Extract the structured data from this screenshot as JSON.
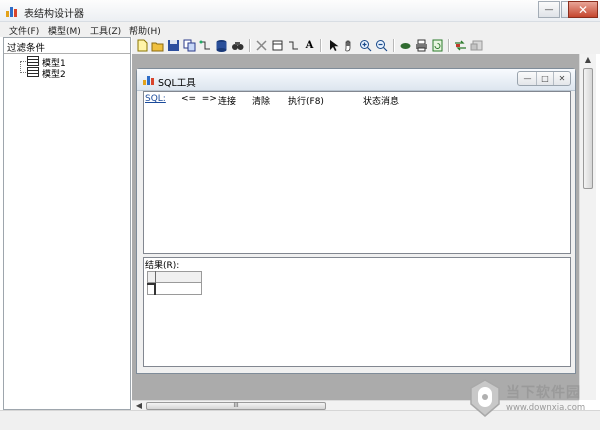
{
  "window": {
    "title": "表结构设计器",
    "buttons": {
      "minimize": "—",
      "maximize": "□",
      "close": "✕"
    }
  },
  "menu": [
    {
      "label": "文件(F)"
    },
    {
      "label": "模型(M)"
    },
    {
      "label": "工具(Z)"
    },
    {
      "label": "帮助(H)"
    }
  ],
  "left_panel": {
    "header": "过滤条件",
    "tree": [
      {
        "label": "模型1"
      },
      {
        "label": "模型2"
      }
    ]
  },
  "toolbar": {
    "icons": [
      "new-file-icon",
      "open-folder-icon",
      "save-icon",
      "copy-icon",
      "relation-icon",
      "database-icon",
      "find-icon",
      "delete-icon",
      "table-icon",
      "connector-icon",
      "text-icon",
      "pointer-icon",
      "hand-icon",
      "zoom-in-icon",
      "zoom-out-icon",
      "leaf-icon",
      "printer-icon",
      "refresh-icon",
      "generate-icon",
      "settings-icon"
    ]
  },
  "sql_window": {
    "title": "SQL工具",
    "toolbar": {
      "prompt": "SQL:",
      "arrows": "<=  =>",
      "connect": "连接",
      "clear": "清除",
      "execute": "执行(F8)",
      "status": "状态消息"
    },
    "results_label": "结果(R):"
  },
  "scrollbar": {
    "grip": "III"
  },
  "watermark": {
    "text": "当下软件园",
    "url": "www.downxia.com"
  },
  "colors": {
    "mdi_background": "#ababab",
    "accent": "#1a4a9a"
  }
}
